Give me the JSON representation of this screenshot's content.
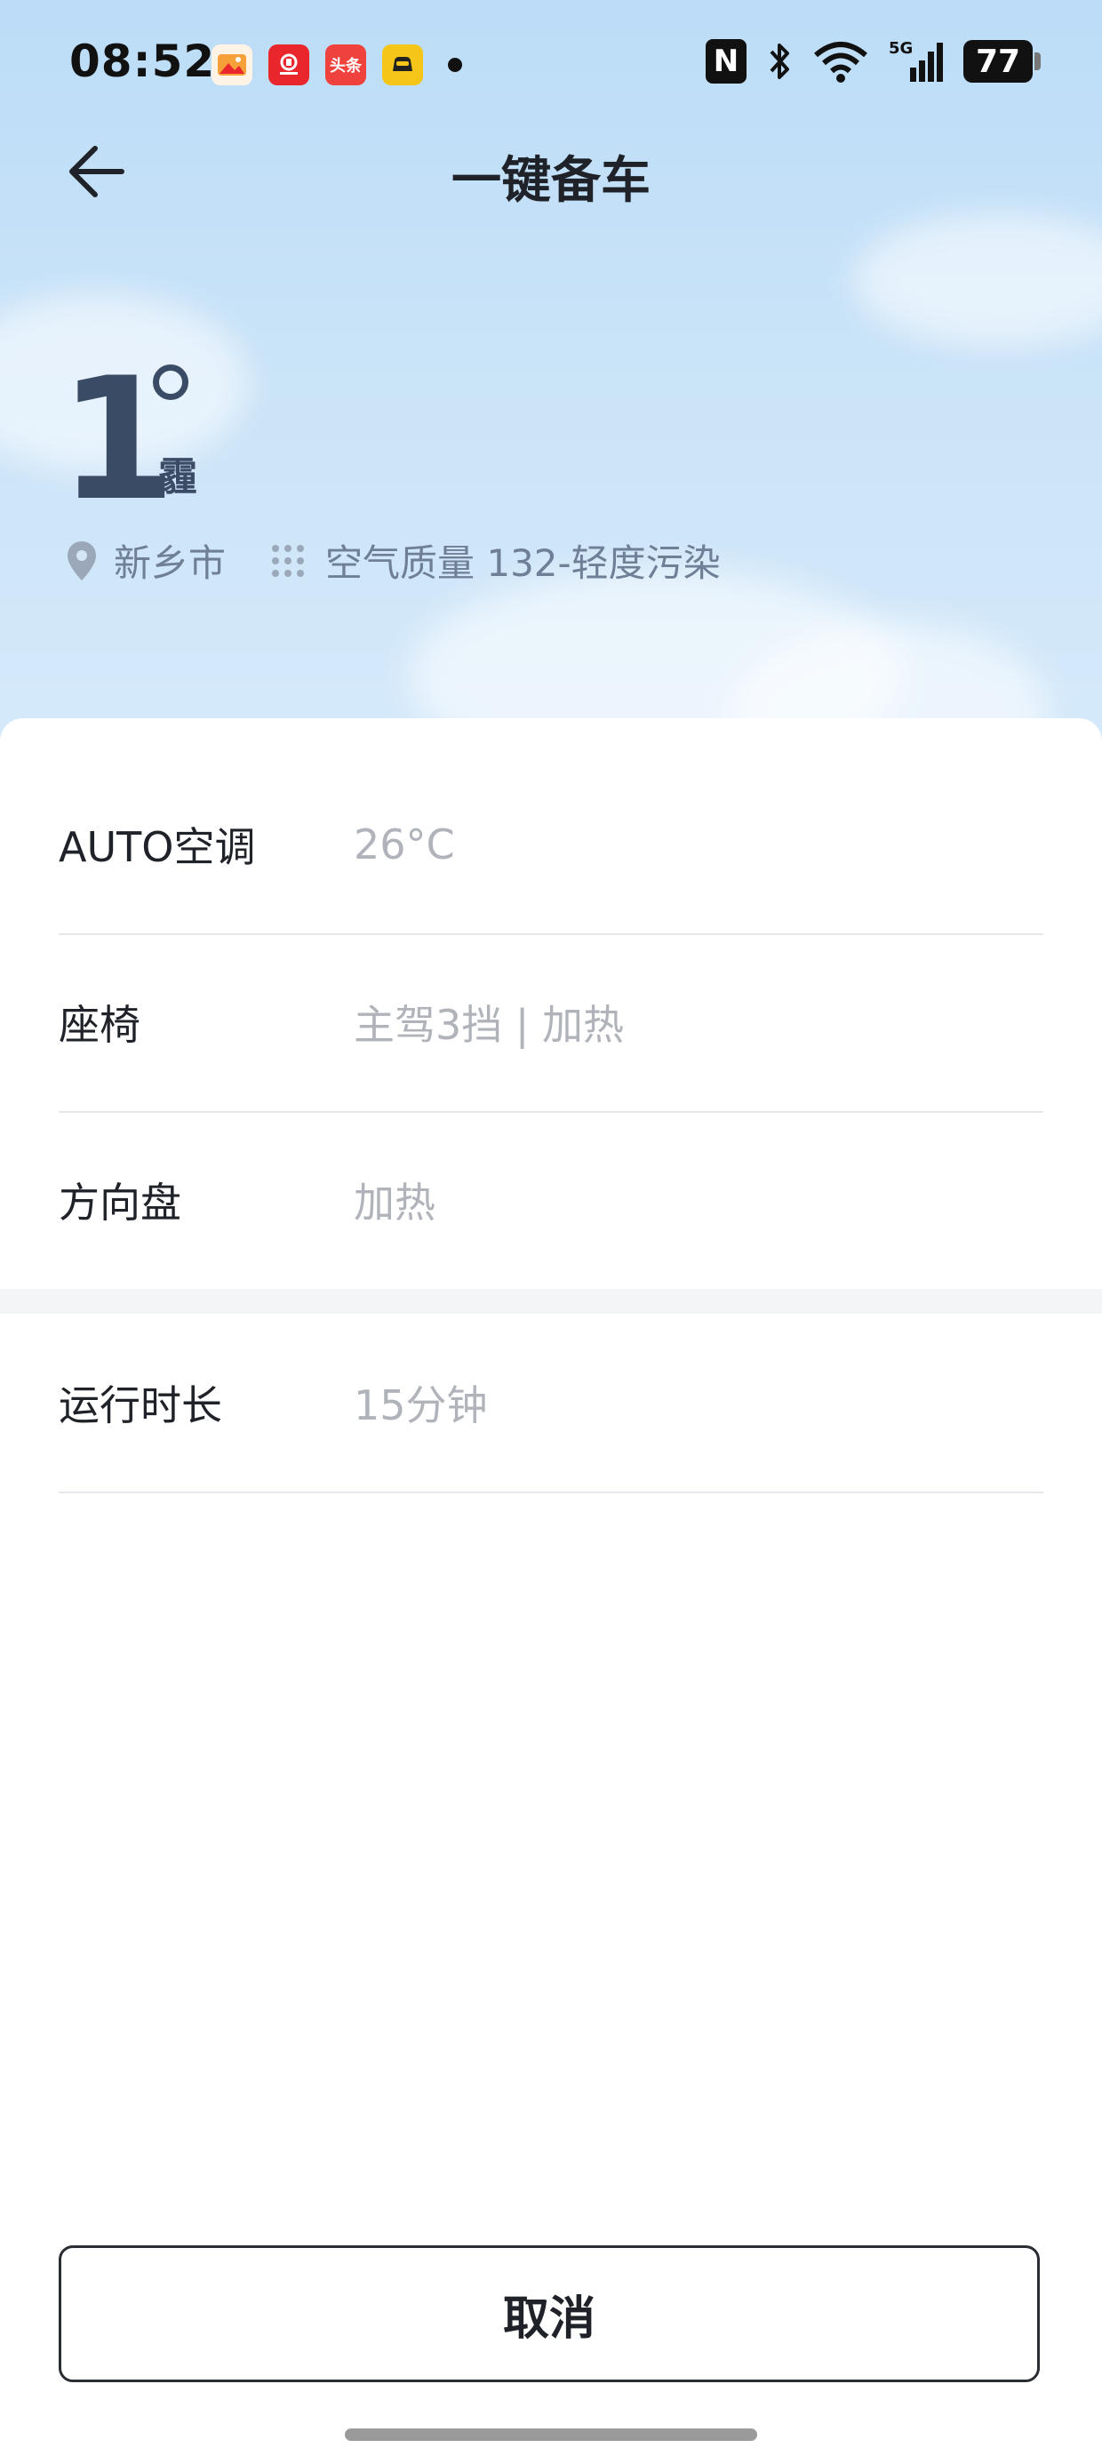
{
  "status_bar": {
    "time": "08:52",
    "app_icons": [
      {
        "name": "gallery-app-icon",
        "text": "",
        "color": "#f6a03a"
      },
      {
        "name": "gwm-app-icon",
        "text": "GWM",
        "color": "#e8262c"
      },
      {
        "name": "toutiao-app-icon",
        "text": "头条",
        "color": "#f0423c"
      },
      {
        "name": "car-app-icon",
        "text": "",
        "color": "#f5c518"
      }
    ],
    "nfc_label": "N",
    "network_label": "5G",
    "battery": "77"
  },
  "header": {
    "title": "一键备车"
  },
  "weather": {
    "temperature": "1",
    "condition": "霾",
    "city": "新乡市",
    "air_quality": "空气质量 132-轻度污染"
  },
  "settings": [
    {
      "label": "AUTO空调",
      "value": "26°C"
    },
    {
      "label": "座椅",
      "value": "主驾3挡 | 加热"
    },
    {
      "label": "方向盘",
      "value": "加热"
    }
  ],
  "duration": {
    "label": "运行时长",
    "value": "15分钟"
  },
  "actions": {
    "cancel_label": "取消"
  },
  "colors": {
    "accent_text": "#3a4b66",
    "secondary_text": "#b0b4ba",
    "sky_top": "#bcdcf7"
  }
}
